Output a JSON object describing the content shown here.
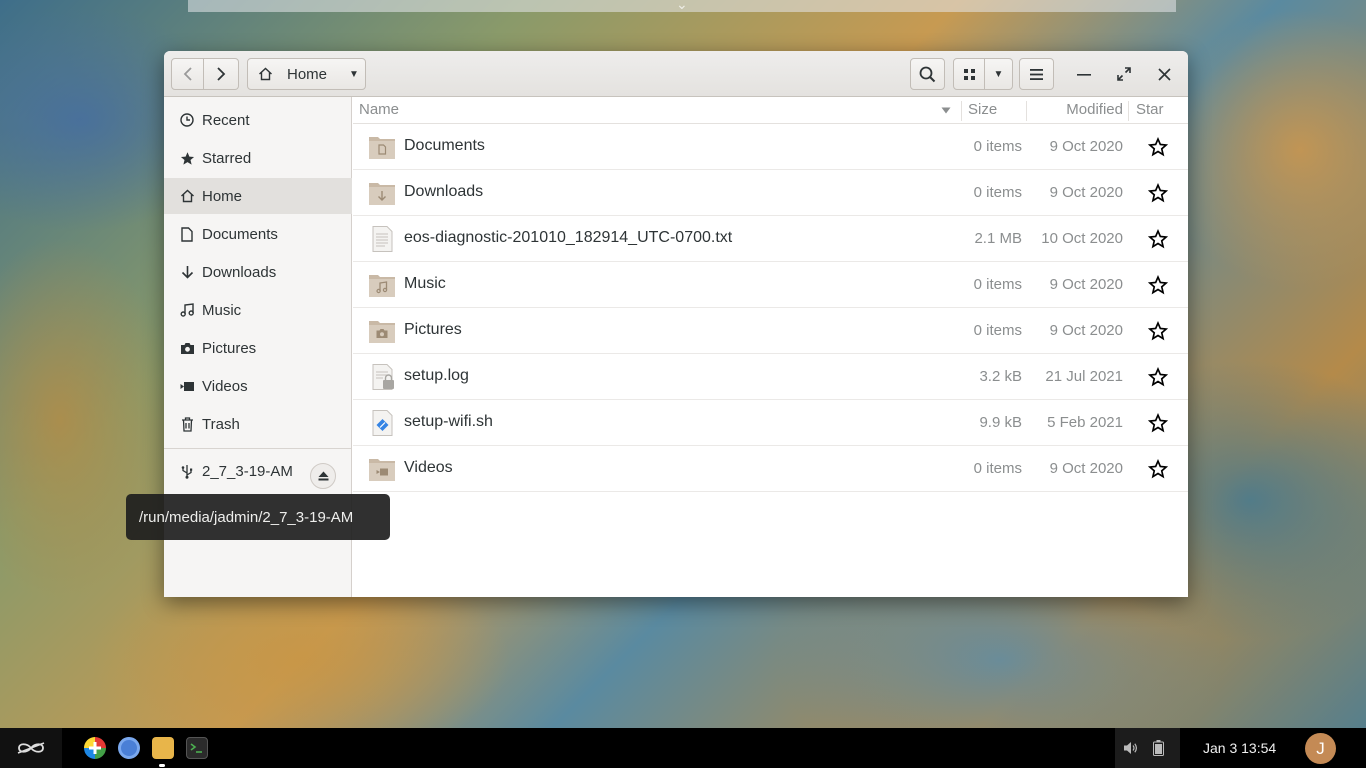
{
  "header": {
    "path_label": "Home"
  },
  "sidebar": {
    "items": [
      {
        "label": "Recent",
        "icon": "clock-icon"
      },
      {
        "label": "Starred",
        "icon": "star-icon"
      },
      {
        "label": "Home",
        "icon": "home-icon",
        "active": true
      },
      {
        "label": "Documents",
        "icon": "document-icon"
      },
      {
        "label": "Downloads",
        "icon": "download-icon"
      },
      {
        "label": "Music",
        "icon": "music-icon"
      },
      {
        "label": "Pictures",
        "icon": "camera-icon"
      },
      {
        "label": "Videos",
        "icon": "video-icon"
      },
      {
        "label": "Trash",
        "icon": "trash-icon"
      }
    ],
    "device": {
      "label": "2_7_3-19-AM",
      "icon": "usb-icon"
    }
  },
  "tooltip": "/run/media/jadmin/2_7_3-19-AM",
  "columns": {
    "name": "Name",
    "size": "Size",
    "modified": "Modified",
    "star": "Star"
  },
  "files": [
    {
      "name": "Documents",
      "size": "0 items",
      "modified": "9 Oct 2020",
      "type": "folder-documents"
    },
    {
      "name": "Downloads",
      "size": "0 items",
      "modified": "9 Oct 2020",
      "type": "folder-downloads"
    },
    {
      "name": "eos-diagnostic-201010_182914_UTC-0700.txt",
      "size": "2.1 MB",
      "modified": "10 Oct 2020",
      "type": "text-file"
    },
    {
      "name": "Music",
      "size": "0 items",
      "modified": "9 Oct 2020",
      "type": "folder-music"
    },
    {
      "name": "Pictures",
      "size": "0 items",
      "modified": "9 Oct 2020",
      "type": "folder-pictures"
    },
    {
      "name": "setup.log",
      "size": "3.2 kB",
      "modified": "21 Jul 2021",
      "type": "log-file"
    },
    {
      "name": "setup-wifi.sh",
      "size": "9.9 kB",
      "modified": "5 Feb 2021",
      "type": "script-file"
    },
    {
      "name": "Videos",
      "size": "0 items",
      "modified": "9 Oct 2020",
      "type": "folder-videos"
    }
  ],
  "taskbar": {
    "apps": [
      "app-center-icon",
      "chromium-icon",
      "files-icon",
      "terminal-icon"
    ],
    "clock": "Jan 3  13:54",
    "avatar_letter": "J"
  },
  "colors": {
    "accent_folder": "#c9b9a6",
    "script_blue": "#3584e4"
  }
}
